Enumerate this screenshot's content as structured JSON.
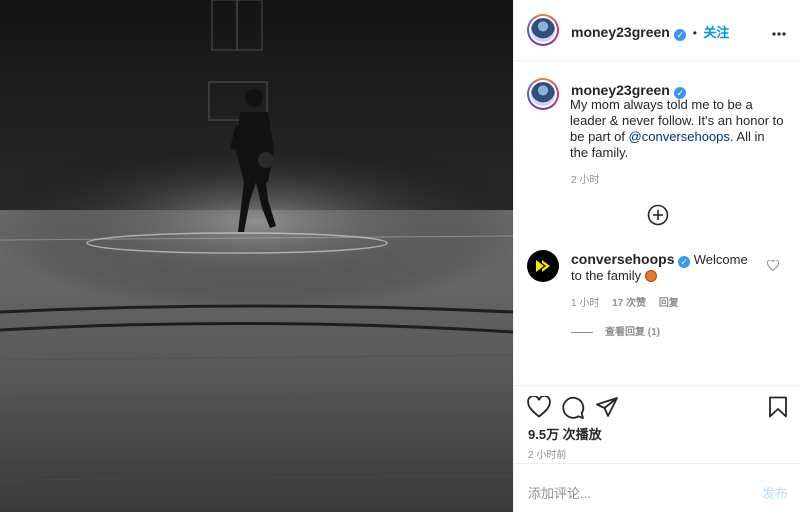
{
  "header": {
    "username": "money23green",
    "follow_label": "关注",
    "dot_sep": "•",
    "more_icon": "more-horizontal-icon"
  },
  "caption": {
    "username": "money23green",
    "text_before": "My mom always told me to be a leader & never follow. It's an honor to be part of ",
    "mention": "@conversehoops",
    "text_after": ". All in the family.",
    "time": "2 小时"
  },
  "load_more_icon": "plus-circle-icon",
  "comment": {
    "username": "conversehoops",
    "text": "Welcome to the family",
    "emoji": "basketball-emoji",
    "time": "1 小时",
    "likes": "17 次赞",
    "reply_label": "回复",
    "view_replies": "查看回复 (1)"
  },
  "actions": {
    "like_icon": "heart-icon",
    "comment_icon": "comment-icon",
    "share_icon": "share-icon",
    "save_icon": "bookmark-icon"
  },
  "stats": {
    "views": "9.5万 次播放",
    "posted": "2 小时前"
  },
  "add_comment": {
    "placeholder": "添加评论...",
    "post_label": "发布"
  },
  "colors": {
    "link_blue": "#0095f6",
    "verified_blue": "#3897f0",
    "secondary_text": "#8e8e8e",
    "mention": "#00376b"
  }
}
